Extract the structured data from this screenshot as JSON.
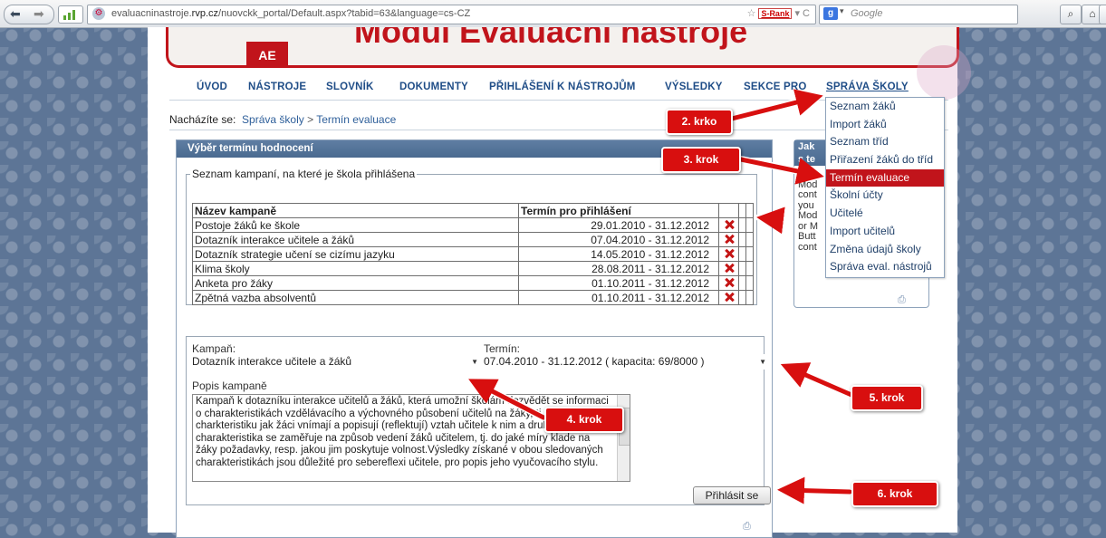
{
  "browser": {
    "url_domain_prefix": "evaluacninastroje.",
    "url_domain_main": "rvp.cz",
    "url_path": "/nuovckk_portal/Default.aspx?tabid=63&language=cs-CZ",
    "srank_label": "S-Rank",
    "search_placeholder": "Google"
  },
  "banner": {
    "logo_text": "AE",
    "title": "Modul Evaluační nástroje"
  },
  "menu": {
    "items": [
      "ÚVOD",
      "NÁSTROJE",
      "SLOVNÍK",
      "DOKUMENTY",
      "PŘIHLÁŠENÍ K NÁSTROJŮM",
      "VÝSLEDKY",
      "SEKCE PRO",
      "SPRÁVA ŠKOLY"
    ]
  },
  "breadcrumb": {
    "prefix": "Nacházíte se:",
    "link": "Správa školy",
    "separator": ">",
    "current": "Termín evaluace"
  },
  "panel": {
    "title": "Výběr termínu hodnocení",
    "fieldset_legend": "Seznam kampaní, na které je škola přihlášena",
    "table": {
      "headers": [
        "Název kampaně",
        "Termín pro přihlášení"
      ],
      "rows": [
        {
          "name": "Postoje žáků ke škole",
          "term": "29.01.2010 - 31.12.2012"
        },
        {
          "name": "Dotazník interakce učitele a žáků",
          "term": "07.04.2010 - 31.12.2012"
        },
        {
          "name": "Dotazník strategie učení se cizímu jazyku",
          "term": "14.05.2010 - 31.12.2012"
        },
        {
          "name": "Klima školy",
          "term": "28.08.2011 - 31.12.2012"
        },
        {
          "name": "Anketa pro žáky",
          "term": "01.10.2011 - 31.12.2012"
        },
        {
          "name": "Zpětná vazba absolventů",
          "term": "01.10.2011 - 31.12.2012"
        }
      ]
    },
    "form": {
      "campaign_label": "Kampaň:",
      "campaign_value": "Dotazník interakce učitele a žáků",
      "term_label": "Termín:",
      "term_value": "07.04.2010 - 31.12.2012 ( kapacita: 69/8000 )",
      "description_label": "Popis kampaně",
      "description": "Kampaň k dotazníku interakce učitelů a žáků, která umožní školám dozvědět se informaci o charakteristikách vzdělávacího a výchovného působení učitelů na žáky, tj. první charkteristiku jak žáci vnímají a popisují (reflektují) vztah učitele k nim a druhá charakteristika se zaměřuje na způsob vedení žáků učitelem, tj. do jaké míry klade na žáky požadavky, resp. jakou jim poskytuje volnost.Výsledky získané v obou sledovaných charakteristikách jsou důležité pro sebereflexi učitele, pro popis jeho vyučovacího stylu.",
      "submit_label": "Přihlásit se"
    }
  },
  "side": {
    "title_line1": "Jak",
    "title_line2": "s te",
    "body_lines": [
      "You",
      "Mod",
      "cont",
      "you",
      "Mod",
      "or M",
      "Butt",
      "cont"
    ]
  },
  "dropdown": {
    "items": [
      "Seznam žáků",
      "Import žáků",
      "Seznam tříd",
      "Přiřazení žáků do tříd",
      "Termín evaluace",
      "Školní účty",
      "Učitelé",
      "Import učitelů",
      "Změna údajů školy",
      "Správa eval. nástrojů"
    ],
    "highlighted_index": 4
  },
  "annotations": {
    "step2": "2. krko",
    "step3": "3. krok",
    "step4": "4. krok",
    "step5": "5. krok",
    "step6": "6. krok"
  },
  "colors": {
    "annotation_red": "#d80f0f",
    "brand_red": "#c1141b",
    "menu_blue": "#1f4d87"
  }
}
